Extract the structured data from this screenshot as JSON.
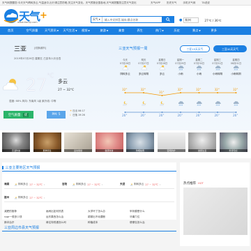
{
  "topbar": {
    "ticker": "天气网提醒您:今天天气晴转多云,气温适中,出行请注意防晒,关注天气变化。天气预报全国各地,天气网提醒您注意天气变化",
    "links": [
      "天气APP",
      "历史天气",
      "手机天气网",
      "TA说说"
    ],
    "sep": "TA说说"
  },
  "header": {
    "logo_text": "天气",
    "logo_plus": "+",
    "logo_url": "www.tianqi.com",
    "search_scope": "天气",
    "search_placeholder": "输入中文拼音,城市/景点名称",
    "city": "杭州",
    "temp": "27℃ / 36℃"
  },
  "nav": {
    "items": [
      {
        "label": "首页",
        "dd": false
      },
      {
        "label": "空气质量",
        "dd": false
      },
      {
        "label": "天气资讯",
        "dd": true
      },
      {
        "label": "天气生活",
        "dd": true
      },
      {
        "label": "视频",
        "dd": true
      },
      {
        "label": "旅游",
        "dd": true
      },
      {
        "label": "美食",
        "dd": false
      },
      {
        "label": "养生",
        "dd": false
      },
      {
        "label": "热门",
        "dd": true
      },
      {
        "label": "历史",
        "dd": false
      },
      {
        "label": "景点",
        "dd": true
      },
      {
        "label": "更多",
        "dd": false
      }
    ]
  },
  "current": {
    "city": "三亚",
    "city_sub": "[切换城市]",
    "date": "2019年07月26日 星期五 己亥年六月廿四",
    "temp": "27",
    "unit": "°C",
    "desc": "多云",
    "range": "27 ~ 32℃",
    "meta": "湿度: 68%  风向: 东南风 1级  紫外线: 中等",
    "aqi_label": "空气质量:",
    "aqi_value": "优",
    "pm": "PM: 5",
    "sunrise": "日出 06:17",
    "sunset": "日落 19:26"
  },
  "forecast": {
    "title": "三亚天气预报一周",
    "tab15": "三亚15天天气",
    "tab40": "三亚40天天气",
    "days": [
      {
        "name": "今天",
        "date": "07月26日",
        "day_icon": "cloud-sun",
        "desc": "阴转多云",
        "night_icon": "moon-cloud"
      },
      {
        "name": "明天",
        "date": "07月27日",
        "day_icon": "cloud-sun",
        "desc": "多云转阴",
        "night_icon": "moon-cloud"
      },
      {
        "name": "星期日",
        "date": "07月28日",
        "day_icon": "cloud-sun",
        "desc": "多云",
        "night_icon": "moon-cloud"
      },
      {
        "name": "星期一",
        "date": "07月29日",
        "day_icon": "rain",
        "desc": "小雨",
        "night_icon": "rain"
      },
      {
        "name": "星期二",
        "date": "07月30日",
        "day_icon": "rain",
        "desc": "小雨",
        "night_icon": "rain"
      },
      {
        "name": "星期三",
        "date": "07月31日",
        "day_icon": "rain",
        "desc": "小雨转阴",
        "night_icon": "rain"
      },
      {
        "name": "星期四",
        "date": "08月01日",
        "day_icon": "rain",
        "desc": "小雨转阴",
        "night_icon": "rain"
      }
    ],
    "highs": [
      "32°",
      "32°",
      "31°",
      "32°",
      "32°",
      "32°",
      "32°"
    ],
    "lows": [
      "26°",
      "26°",
      "26°",
      "26°",
      "26°",
      "26°",
      "26°"
    ]
  },
  "banners": [
    {
      "caption": "高温防暑"
    },
    {
      "caption": "夏季养生"
    },
    {
      "caption": "运动保健"
    },
    {
      "caption": "健康饮食"
    },
    {
      "caption": "防晒指南"
    },
    {
      "caption": "雷雨防护"
    },
    {
      "caption": "健康生活"
    },
    {
      "caption": "科普知识"
    }
  ],
  "area": {
    "title": "三亚主要地区天气预报",
    "rows": [
      [
        {
          "name": "海棠",
          "w": "阴转多云",
          "t": "27 ~ 32℃"
        },
        {
          "name": "吉阳",
          "w": "阴转多云",
          "t": "27 ~ 32℃"
        },
        {
          "name": "天涯",
          "w": "阴转多云",
          "t": "27 ~ 32℃"
        }
      ],
      [
        {
          "name": "崖州",
          "w": "阴转多云",
          "t": "27 ~ 32℃"
        }
      ]
    ],
    "links": [
      [
        "减肥的推荐",
        "画闹出如何热表",
        "大学环了怎么办",
        "甲状腺是什么"
      ],
      [
        "rpgr一般多少钱",
        "运东果西怎么治",
        "颠颠出不动要断",
        "牙痛穴位"
      ],
      [
        "肺冲治疗",
        "蒋往特别遇怎么呵",
        "种植成本",
        "便便包怎么治"
      ]
    ]
  },
  "sidebar": {
    "hot_title": "热点推荐",
    "hot_badge": "HOT"
  },
  "area2": {
    "title": "三亚周边市县天气预报"
  },
  "colors": {
    "brand": "#1a7fe2",
    "aqi_good": "#2bb56a",
    "high_temp": "#f39800",
    "low_temp": "#5a8fd1"
  }
}
